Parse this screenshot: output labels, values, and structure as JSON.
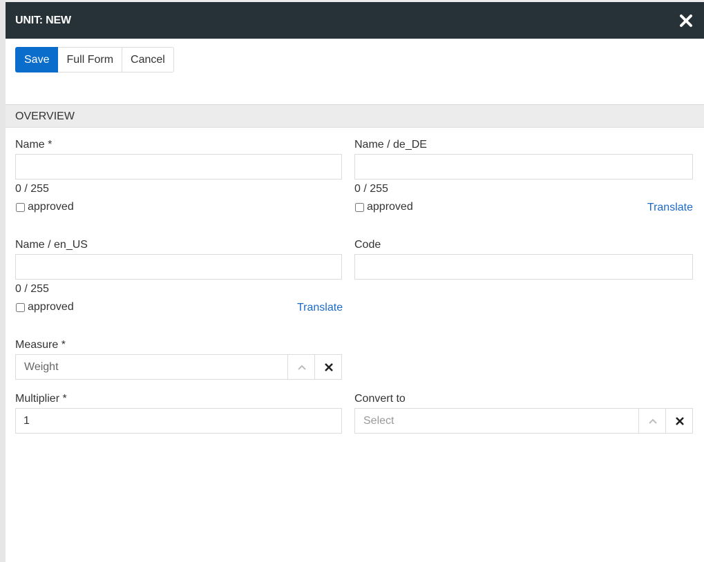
{
  "modal": {
    "title": "UNIT: NEW"
  },
  "toolbar": {
    "save_label": "Save",
    "full_form_label": "Full Form",
    "cancel_label": "Cancel"
  },
  "section": {
    "title": "OVERVIEW"
  },
  "fields": {
    "name": {
      "label": "Name *",
      "value": "",
      "counter": "0 / 255",
      "approved_label": "approved",
      "approved": false
    },
    "name_de": {
      "label": "Name / de_DE",
      "value": "",
      "counter": "0 / 255",
      "approved_label": "approved",
      "approved": false,
      "translate_label": "Translate"
    },
    "name_en": {
      "label": "Name / en_US",
      "value": "",
      "counter": "0 / 255",
      "approved_label": "approved",
      "approved": false,
      "translate_label": "Translate"
    },
    "code": {
      "label": "Code",
      "value": ""
    },
    "measure": {
      "label": "Measure *",
      "value": "Weight"
    },
    "multiplier": {
      "label": "Multiplier *",
      "value": "1"
    },
    "convert_to": {
      "label": "Convert to",
      "placeholder": "Select"
    }
  },
  "icons": {
    "close": "close-icon",
    "chevron_up": "chevron-up-icon",
    "clear": "clear-icon"
  },
  "colors": {
    "header_bg": "#263238",
    "primary": "#0a6ccb",
    "link": "#1b6ac9"
  }
}
